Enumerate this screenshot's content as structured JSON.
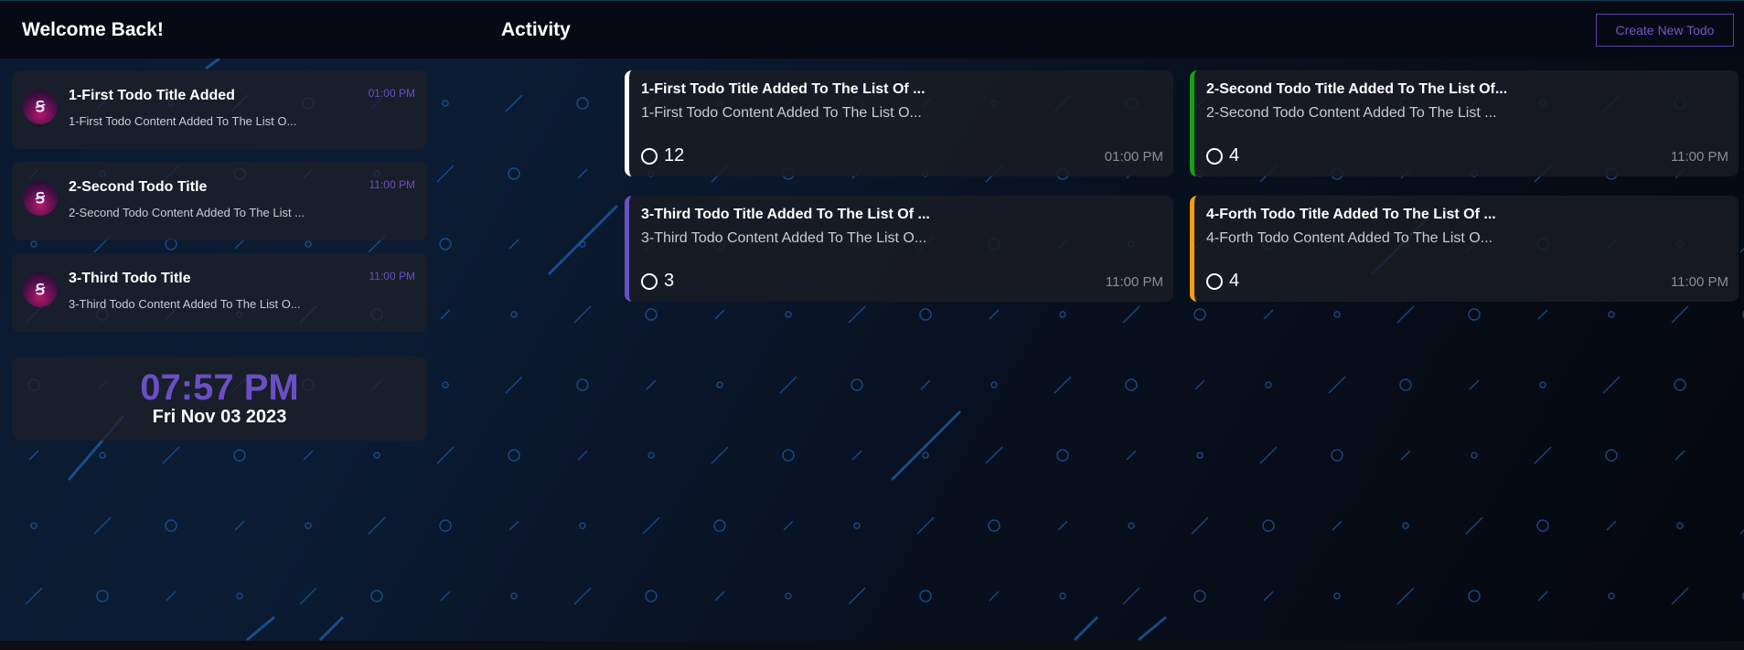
{
  "header": {
    "welcome": "Welcome Back!",
    "activity": "Activity",
    "create_button": "Create New Todo"
  },
  "sidebar": {
    "items": [
      {
        "title": "1-First Todo Title Added",
        "content": "1-First Todo Content Added To The List O...",
        "time": "01:00 PM"
      },
      {
        "title": "2-Second Todo Title",
        "content": "2-Second Todo Content Added To The List ...",
        "time": "11:00 PM"
      },
      {
        "title": "3-Third Todo Title",
        "content": "3-Third Todo Content Added To The List O...",
        "time": "11:00 PM"
      }
    ],
    "avatar_glyph": "Ꞩ"
  },
  "clock": {
    "time": "07:57 PM",
    "date": "Fri Nov 03 2023"
  },
  "cards": [
    {
      "title": "1-First Todo Title Added To The List Of ...",
      "content": "1-First Todo Content Added To The List O...",
      "count": "12",
      "time": "01:00 PM",
      "color": "#ffffff"
    },
    {
      "title": "2-Second Todo Title Added To The List Of...",
      "content": "2-Second Todo Content Added To The List ...",
      "count": "4",
      "time": "11:00 PM",
      "color": "#12a312"
    },
    {
      "title": "3-Third Todo Title Added To The List Of ...",
      "content": "3-Third Todo Content Added To The List O...",
      "count": "3",
      "time": "11:00 PM",
      "color": "#6b4fc4"
    },
    {
      "title": "4-Forth Todo Title Added To The List Of ...",
      "content": "4-Forth Todo Content Added To The List O...",
      "count": "4",
      "time": "11:00 PM",
      "color": "#f5a00a"
    }
  ],
  "colors": {
    "accent": "#6b4fc4",
    "pattern": "#1f5fa8"
  }
}
